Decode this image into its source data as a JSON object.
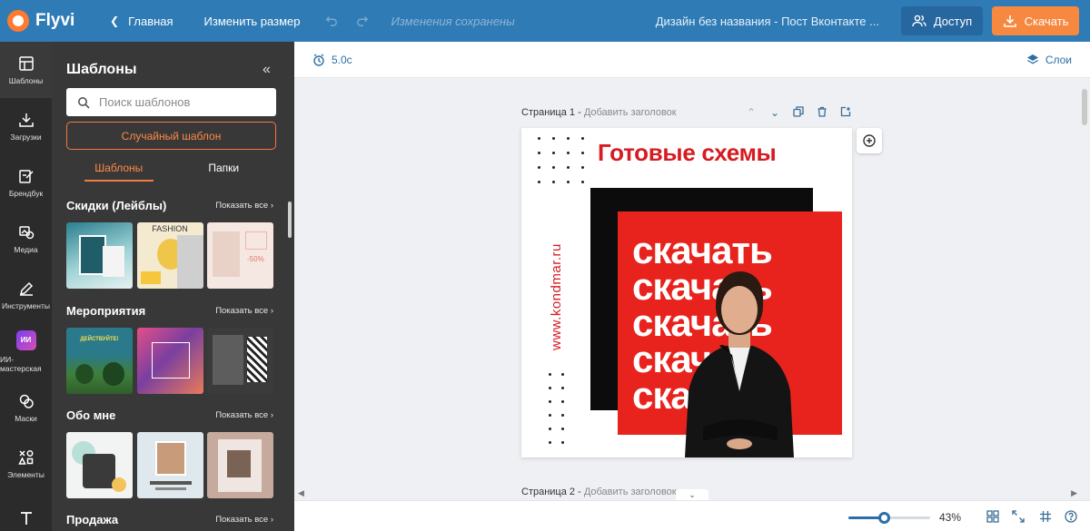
{
  "topbar": {
    "brand": "Flyvi",
    "back_label": "Главная",
    "resize_label": "Изменить размер",
    "saved_status": "Изменения сохранены",
    "doc_title": "Дизайн без названия - Пост Вконтакте ...",
    "access_label": "Доступ",
    "download_label": "Скачать"
  },
  "rail": {
    "templates": "Шаблоны",
    "uploads": "Загрузки",
    "brandbook": "Брендбук",
    "media": "Медиа",
    "tools": "Инструменты",
    "ai_badge": "ИИ",
    "ai_studio": "ИИ-мастерская",
    "masks": "Маски",
    "elements": "Элементы"
  },
  "panel": {
    "title": "Шаблоны",
    "search_placeholder": "Поиск шаблонов",
    "random_label": "Случайный шаблон",
    "tabs": [
      "Шаблоны",
      "Папки"
    ],
    "show_all": "Показать все",
    "sections": [
      {
        "title": "Скидки (Лейблы)"
      },
      {
        "title": "Мероприятия"
      },
      {
        "title": "Обо мне"
      },
      {
        "title": "Продажа"
      }
    ],
    "thumb_texts": {
      "fashion": "FASHION",
      "sale": "-50%",
      "action": "ДЕЙСТВУЙТЕ!"
    }
  },
  "workspace": {
    "duration": "5.0с",
    "layers_label": "Слои",
    "page1_label": "Страница 1 -",
    "page1_add_title": "Добавить заголовок",
    "page2_label": "Страница 2 -",
    "page2_add_title": "Добавить заголовок"
  },
  "design": {
    "headline": "Готовые схемы",
    "repeat_word": "скачать",
    "url": "www.kondmar.ru"
  },
  "zoom": {
    "value": 0.43,
    "label": "43%"
  },
  "colors": {
    "topbar": "#2f7bb5",
    "accent_orange": "#f7883f",
    "design_red": "#e8231d",
    "panel_bg": "#383838",
    "rail_bg": "#2b2b2b"
  }
}
